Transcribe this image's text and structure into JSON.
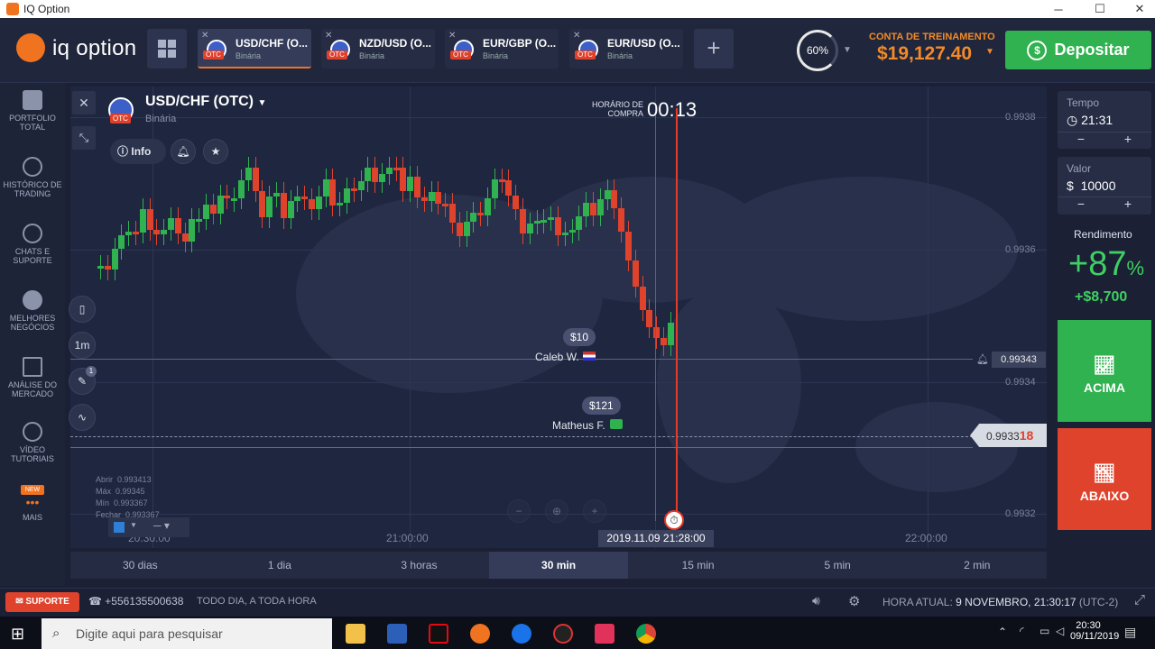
{
  "window": {
    "title": "IQ Option"
  },
  "header": {
    "brand": "iq option",
    "tabs": [
      {
        "name": "USD/CHF (O...",
        "sub": "Binária",
        "otc": "OTC",
        "active": true
      },
      {
        "name": "NZD/USD (O...",
        "sub": "Binária",
        "otc": "OTC",
        "active": false
      },
      {
        "name": "EUR/GBP (O...",
        "sub": "Binária",
        "otc": "OTC",
        "active": false
      },
      {
        "name": "EUR/USD (O...",
        "sub": "Binária",
        "otc": "OTC",
        "active": false
      }
    ],
    "percent": "60%",
    "account_label": "CONTA DE TREINAMENTO",
    "account_value": "$19,127.40",
    "deposit_label": "Depositar"
  },
  "nav": [
    {
      "label": "PORTFOLIO TOTAL"
    },
    {
      "label": "HISTÓRICO DE TRADING"
    },
    {
      "label": "CHATS E SUPORTE"
    },
    {
      "label": "MELHORES NEGÓCIOS"
    },
    {
      "label": "ANÁLISE DO MERCADO"
    },
    {
      "label": "VÍDEO TUTORIAIS"
    },
    {
      "label": "MAIS",
      "badge": "NEW"
    }
  ],
  "asset": {
    "title": "USD/CHF (OTC)",
    "type": "Binária",
    "info": "Info",
    "otc": "OTC"
  },
  "chart_tools": {
    "interval": "1m",
    "pen_badge": "1"
  },
  "timer": {
    "label": "HORÁRIO DE COMPRA",
    "value": "00:13"
  },
  "chart_data": {
    "type": "candlestick",
    "y_ticks": [
      "0.9938",
      "0.9936",
      "0.9934",
      "0.9932"
    ],
    "x_ticks": [
      "20:30:00",
      "21:00:00",
      "22:00:00"
    ],
    "current_price": "0.9933",
    "current_price_suffix": "18",
    "alert_price": "0.99343",
    "cursor_time": "2019.11.09 21:28:00",
    "ohlc": {
      "labels": [
        "Abrir",
        "Máx",
        "Mín",
        "Fechar"
      ],
      "values": [
        "0.993413",
        "0.99345",
        "0.993367",
        "0.993367"
      ]
    },
    "trades": [
      {
        "amount": "$10",
        "trader": "Caleb W."
      },
      {
        "amount": "$121",
        "trader": "Matheus F."
      }
    ]
  },
  "periods": [
    {
      "label": "30 dias"
    },
    {
      "label": "1 dia"
    },
    {
      "label": "3 horas"
    },
    {
      "label": "30 min",
      "active": true
    },
    {
      "label": "15 min"
    },
    {
      "label": "5 min"
    },
    {
      "label": "2 min"
    }
  ],
  "right": {
    "time_label": "Tempo",
    "time_value": "21:31",
    "amount_label": "Valor",
    "amount_currency": "$",
    "amount_value": "10000",
    "yield_label": "Rendimento",
    "yield_pct": "+87",
    "yield_pct_sign": "%",
    "yield_amount": "+$8,700",
    "up_label": "ACIMA",
    "down_label": "ABAIXO",
    "minus": "−",
    "plus": "+"
  },
  "footer": {
    "support": "SUPORTE",
    "phone": "+556135500638",
    "hours": "TODO DIA, A TODA HORA",
    "time_label": "HORA ATUAL:",
    "time_value": "9 NOVEMBRO, 21:30:17",
    "tz": "(UTC-2)"
  },
  "taskbar": {
    "search_placeholder": "Digite aqui para pesquisar",
    "clock_time": "20:30",
    "clock_date": "09/11/2019"
  },
  "colors": {
    "up": "#2fb24f",
    "down": "#e0432c",
    "accent": "#f07320",
    "bg": "#1f2740"
  }
}
